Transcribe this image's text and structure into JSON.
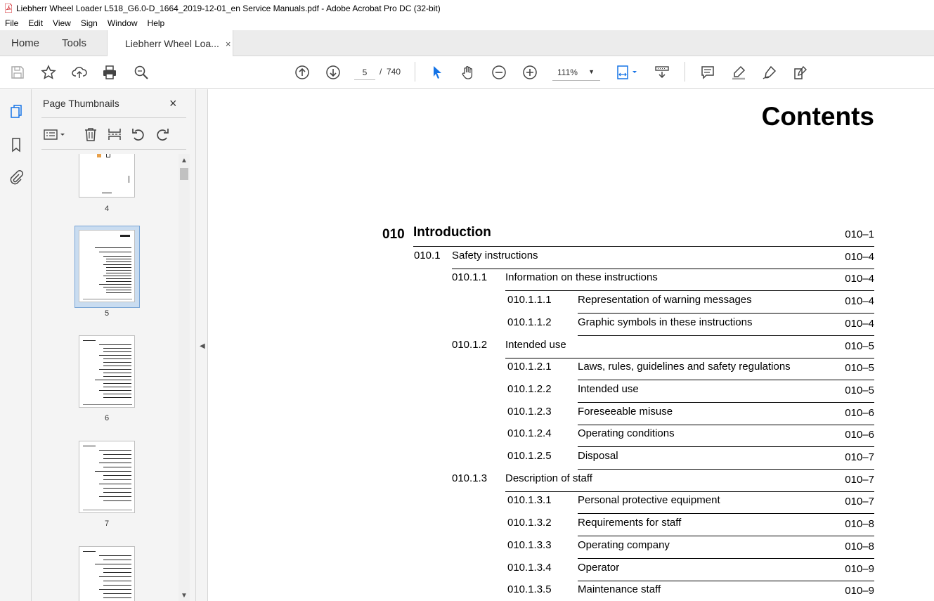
{
  "window": {
    "title": "Liebherr Wheel Loader L518_G6.0-D_1664_2019-12-01_en Service Manuals.pdf - Adobe Acrobat Pro DC (32-bit)"
  },
  "menu": [
    "File",
    "Edit",
    "View",
    "Sign",
    "Window",
    "Help"
  ],
  "tabs": {
    "home": "Home",
    "tools": "Tools",
    "document": "Liebherr Wheel Loa...",
    "close": "×"
  },
  "toolbar": {
    "page_current": "5",
    "page_sep": "/",
    "page_total": "740",
    "zoom": "111%",
    "icons": [
      "save-icon",
      "bookmark-star-icon",
      "upload-icon",
      "print-icon",
      "search-zoom-icon",
      "prev-page-icon",
      "next-page-icon",
      "select-cursor-icon",
      "hand-icon",
      "zoom-out-icon",
      "zoom-in-icon",
      "fit-page-icon",
      "scroll-mode-icon",
      "comment-icon",
      "highlight-icon",
      "sign-icon",
      "fill-sign-icon"
    ]
  },
  "panel": {
    "title": "Page Thumbnails",
    "close": "×",
    "thumbnails": [
      {
        "label": "4",
        "selected": false
      },
      {
        "label": "5",
        "selected": true
      },
      {
        "label": "6",
        "selected": false
      },
      {
        "label": "7",
        "selected": false
      },
      {
        "label": "",
        "selected": false
      }
    ]
  },
  "document": {
    "heading": "Contents",
    "toc": [
      {
        "level": 0,
        "num": "010",
        "text": "Introduction",
        "page": "010–1"
      },
      {
        "level": 1,
        "num": "010.1",
        "text": "Safety instructions",
        "page": "010–4"
      },
      {
        "level": 2,
        "num": "010.1.1",
        "text": "Information on these instructions",
        "page": "010–4"
      },
      {
        "level": 3,
        "num": "010.1.1.1",
        "text": "Representation of warning messages",
        "page": "010–4"
      },
      {
        "level": 3,
        "num": "010.1.1.2",
        "text": "Graphic symbols in these instructions",
        "page": "010–4"
      },
      {
        "level": 2,
        "num": "010.1.2",
        "text": "Intended use",
        "page": "010–5"
      },
      {
        "level": 3,
        "num": "010.1.2.1",
        "text": "Laws, rules, guidelines and safety regulations",
        "page": "010–5"
      },
      {
        "level": 3,
        "num": "010.1.2.2",
        "text": "Intended use",
        "page": "010–5"
      },
      {
        "level": 3,
        "num": "010.1.2.3",
        "text": "Foreseeable misuse",
        "page": "010–6"
      },
      {
        "level": 3,
        "num": "010.1.2.4",
        "text": "Operating conditions",
        "page": "010–6"
      },
      {
        "level": 3,
        "num": "010.1.2.5",
        "text": "Disposal",
        "page": "010–7"
      },
      {
        "level": 2,
        "num": "010.1.3",
        "text": "Description of staff",
        "page": "010–7"
      },
      {
        "level": 3,
        "num": "010.1.3.1",
        "text": "Personal protective equipment",
        "page": "010–7"
      },
      {
        "level": 3,
        "num": "010.1.3.2",
        "text": "Requirements for staff",
        "page": "010–8"
      },
      {
        "level": 3,
        "num": "010.1.3.3",
        "text": "Operating company",
        "page": "010–8"
      },
      {
        "level": 3,
        "num": "010.1.3.4",
        "text": "Operator",
        "page": "010–9"
      },
      {
        "level": 3,
        "num": "010.1.3.5",
        "text": "Maintenance staff",
        "page": "010–9"
      }
    ]
  },
  "colors": {
    "accent_blue": "#1473e6",
    "selection": "#c9dcf0",
    "pdf_red": "#d1262b"
  }
}
